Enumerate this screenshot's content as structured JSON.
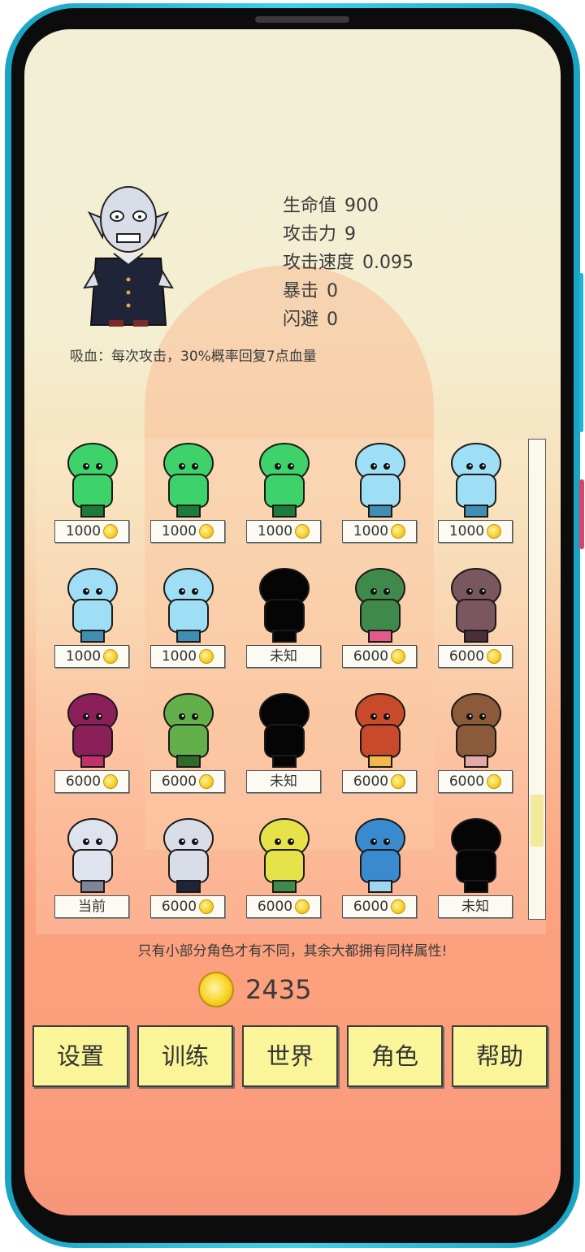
{
  "hero": {
    "stats": [
      {
        "label": "生命值",
        "value": "900"
      },
      {
        "label": "攻击力",
        "value": "9"
      },
      {
        "label": "攻击速度",
        "value": "0.095"
      },
      {
        "label": "暴击",
        "value": "0"
      },
      {
        "label": "闪避",
        "value": "0"
      }
    ],
    "skill": "吸血：每次攻击，30%概率回复7点血量",
    "icon": "vampire-sprite"
  },
  "characters": [
    {
      "sprite": "green-mushroom-cat",
      "price": "1000",
      "coin": true
    },
    {
      "sprite": "green-mushroom-frog",
      "price": "1000",
      "coin": true
    },
    {
      "sprite": "green-mushroom-frog-2",
      "price": "1000",
      "coin": true
    },
    {
      "sprite": "ice-mushroom-girl",
      "price": "1000",
      "coin": true
    },
    {
      "sprite": "ice-mushroom-cap",
      "price": "1000",
      "coin": true
    },
    {
      "sprite": "ice-bunny-ears",
      "price": "1000",
      "coin": true
    },
    {
      "sprite": "ice-mushroom-boy",
      "price": "1000",
      "coin": true
    },
    {
      "sprite": "locked-silhouette",
      "price": "未知",
      "coin": false
    },
    {
      "sprite": "plant-monster",
      "price": "6000",
      "coin": true
    },
    {
      "sprite": "mud-slime",
      "price": "6000",
      "coin": true
    },
    {
      "sprite": "purple-snake",
      "price": "6000",
      "coin": true
    },
    {
      "sprite": "green-frog-mage",
      "price": "6000",
      "coin": true
    },
    {
      "sprite": "locked-silhouette",
      "price": "未知",
      "coin": false
    },
    {
      "sprite": "red-dragon",
      "price": "6000",
      "coin": true
    },
    {
      "sprite": "brown-rat",
      "price": "6000",
      "coin": true
    },
    {
      "sprite": "white-werewolf",
      "price": "当前",
      "coin": false
    },
    {
      "sprite": "vampire",
      "price": "6000",
      "coin": true
    },
    {
      "sprite": "yellow-turtle",
      "price": "6000",
      "coin": true
    },
    {
      "sprite": "blue-crocodile",
      "price": "6000",
      "coin": true
    },
    {
      "sprite": "locked-silhouette",
      "price": "未知",
      "coin": false
    }
  ],
  "notice": "只有小部分角色才有不同，其余大都拥有同样属性!",
  "balance": "2435",
  "menu": [
    "设置",
    "训练",
    "世界",
    "角色",
    "帮助"
  ],
  "colors": {
    "button_fill": "#fbf59a",
    "coin": "#f7d22f",
    "text": "#3a3a3a",
    "frame": "#1aa3c4"
  }
}
